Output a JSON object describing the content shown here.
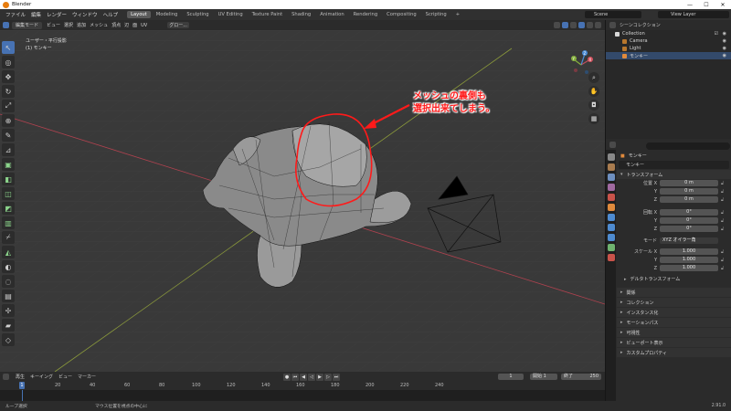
{
  "window": {
    "title": "Blender",
    "buttons": [
      "—",
      "☐",
      "✕"
    ]
  },
  "menubar": {
    "items": [
      "ファイル",
      "編集",
      "レンダー",
      "ウィンドウ",
      "ヘルプ"
    ],
    "workspaces": [
      "Layout",
      "Modeling",
      "Sculpting",
      "UV Editing",
      "Texture Paint",
      "Shading",
      "Animation",
      "Rendering",
      "Compositing",
      "Scripting",
      "+"
    ],
    "active_workspace": "Layout",
    "scene": "Scene",
    "view_layer": "View Layer"
  },
  "viewport_header": {
    "mode": "編集モード",
    "menus": [
      "ビュー",
      "選択",
      "追加",
      "メッシュ",
      "頂点",
      "辺",
      "面",
      "UV"
    ],
    "transform": "グロー..."
  },
  "viewport": {
    "info_line1": "ユーザー・平行投影",
    "info_line2": "(1) モンキー",
    "annotation_line1": "メッシュの裏側も",
    "annotation_line2": "選択出来てしまう。",
    "gizmo_axes": {
      "x": "X",
      "y": "Y",
      "z": "Z"
    }
  },
  "toolbar": {
    "tools": [
      "select-icon",
      "cursor-icon",
      "move-icon",
      "rotate-icon",
      "scale-icon",
      "transform-icon",
      "annotate-icon",
      "measure-icon",
      "add-cube-icon",
      "extrude-icon",
      "inset-icon",
      "bevel-icon",
      "loopcut-icon",
      "knife-icon",
      "polybuild-icon",
      "spin-icon",
      "smooth-icon",
      "edge-slide-icon",
      "shrink-icon",
      "shear-icon",
      "rip-icon"
    ]
  },
  "timeline": {
    "menus": [
      "再生",
      "キーイング",
      "ビュー",
      "マーカー"
    ],
    "current_frame": "1",
    "start_label": "開始",
    "start": "1",
    "end_label": "終了",
    "end": "250",
    "ticks": [
      "1",
      "20",
      "40",
      "60",
      "80",
      "100",
      "120",
      "140",
      "160",
      "180",
      "200",
      "220",
      "240",
      "250"
    ],
    "playhead": "1"
  },
  "statusbar": {
    "item1": "ループ選択",
    "item2": "マウス位置を視点の中心に",
    "item3": "",
    "version": "2.91.0"
  },
  "outliner": {
    "title": "シーンコレクション",
    "rows": [
      {
        "label": "Collection",
        "indent": 1,
        "color": "#d8d8d8"
      },
      {
        "label": "Camera",
        "indent": 2,
        "color": "#b8772d"
      },
      {
        "label": "Light",
        "indent": 2,
        "color": "#b8772d"
      },
      {
        "label": "モンキー",
        "indent": 2,
        "color": "#e08a3c"
      }
    ]
  },
  "properties": {
    "object_label": "モンキー",
    "object_name": "モンキー",
    "transform_section": "トランスフォーム",
    "location_label": "位置 X",
    "rotation_label": "回転 X",
    "scale_label": "スケール X",
    "y_label": "Y",
    "z_label": "Z",
    "location": [
      "0 m",
      "0 m",
      "0 m"
    ],
    "rotation": [
      "0°",
      "0°",
      "0°"
    ],
    "mode_label": "モード",
    "mode_value": "XYZ オイラー角",
    "scale": [
      "1.000",
      "1.000",
      "1.000"
    ],
    "delta_section": "デルタトランスフォーム",
    "sections": [
      "関係",
      "コレクション",
      "インスタンス化",
      "モーションパス",
      "可視性",
      "ビューポート表示",
      "カスタムプロパティ"
    ]
  }
}
